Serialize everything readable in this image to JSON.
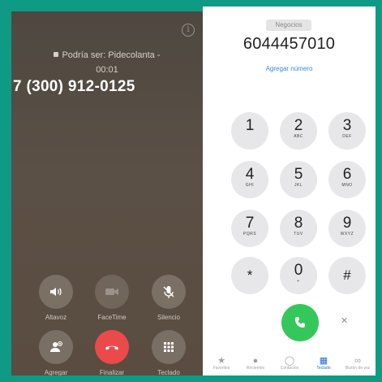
{
  "colors": {
    "background": "#0f9a86",
    "end_call": "#ea4a4a",
    "call": "#34c759",
    "accent": "#1f6fd6",
    "link": "#3a86d6"
  },
  "in_call": {
    "info_icon": "info-icon",
    "caller_label": "Podría ser: Pidecolanta -",
    "timer": "00:01",
    "number": "7 (300) 912-0125",
    "buttons": [
      {
        "label": "Altavoz",
        "icon": "speaker-icon"
      },
      {
        "label": "FaceTime",
        "icon": "video-icon"
      },
      {
        "label": "Silencio",
        "icon": "mic-mute-icon"
      },
      {
        "label": "Agregar",
        "icon": "add-call-icon"
      },
      {
        "label": "Finalizar",
        "icon": "end-call-icon"
      },
      {
        "label": "Teclado",
        "icon": "keypad-icon"
      }
    ]
  },
  "keypad": {
    "badge": "Negocios",
    "dialed_number": "6044457010",
    "add_number": "Agregar número",
    "keys": [
      {
        "digit": "1",
        "letters": ""
      },
      {
        "digit": "2",
        "letters": "ABC"
      },
      {
        "digit": "3",
        "letters": "DEF"
      },
      {
        "digit": "4",
        "letters": "GHI"
      },
      {
        "digit": "5",
        "letters": "JKL"
      },
      {
        "digit": "6",
        "letters": "MNO"
      },
      {
        "digit": "7",
        "letters": "PQRS"
      },
      {
        "digit": "8",
        "letters": "TUV"
      },
      {
        "digit": "9",
        "letters": "WXYZ"
      },
      {
        "digit": "*",
        "letters": ""
      },
      {
        "digit": "0",
        "letters": "+"
      },
      {
        "digit": "#",
        "letters": ""
      }
    ],
    "call_icon": "phone-icon",
    "delete_icon": "delete-icon",
    "tabs": [
      {
        "label": "Favoritos",
        "icon": "star-icon"
      },
      {
        "label": "Recientes",
        "icon": "clock-icon"
      },
      {
        "label": "Contactos",
        "icon": "contact-icon"
      },
      {
        "label": "Teclado",
        "icon": "keypad-icon"
      },
      {
        "label": "Buzón de voz",
        "icon": "voicemail-icon"
      }
    ]
  }
}
